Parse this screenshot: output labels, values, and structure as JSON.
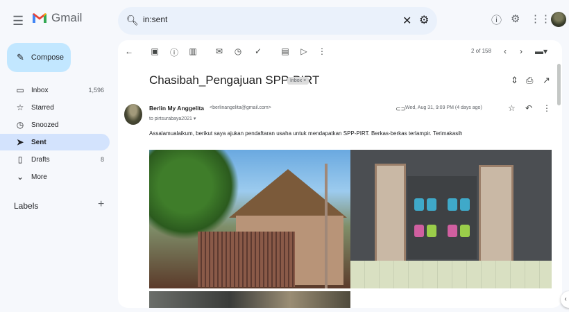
{
  "app": {
    "name": "Gmail"
  },
  "search": {
    "value": "in:sent",
    "placeholder": "Search mail"
  },
  "sidebar": {
    "compose_label": "Compose",
    "items": [
      {
        "label": "Inbox",
        "count": "1,596",
        "icon": "inbox-icon"
      },
      {
        "label": "Starred",
        "count": "",
        "icon": "star-icon"
      },
      {
        "label": "Snoozed",
        "count": "",
        "icon": "clock-icon"
      },
      {
        "label": "Sent",
        "count": "",
        "icon": "send-icon",
        "active": true
      },
      {
        "label": "Drafts",
        "count": "8",
        "icon": "draft-icon"
      },
      {
        "label": "More",
        "count": "",
        "icon": "chevron-down-icon"
      }
    ],
    "labels_title": "Labels"
  },
  "toolbar": {
    "pager": "2 of 158"
  },
  "email": {
    "subject": "Chasibah_Pengajuan SPP-PIRT",
    "chip": "Inbox ×",
    "sender_name": "Berlin My Anggelita",
    "sender_email": "<berlinangelita@gmail.com>",
    "to": "to pirtsurabaya2021 ▾",
    "date": "Wed, Aug 31, 9:09 PM (4 days ago)",
    "body": "Assalamualaikum, berikut saya ajukan pendaftaran usaha untuk mendapatkan SPP-PIRT. Berkas-berkas terlampir. Terimakasih"
  },
  "colors": {
    "compose_bg": "#c2e7ff",
    "active_nav": "#d3e3fd",
    "search_bg": "#eaf1fb",
    "page_bg": "#f6f8fc"
  }
}
